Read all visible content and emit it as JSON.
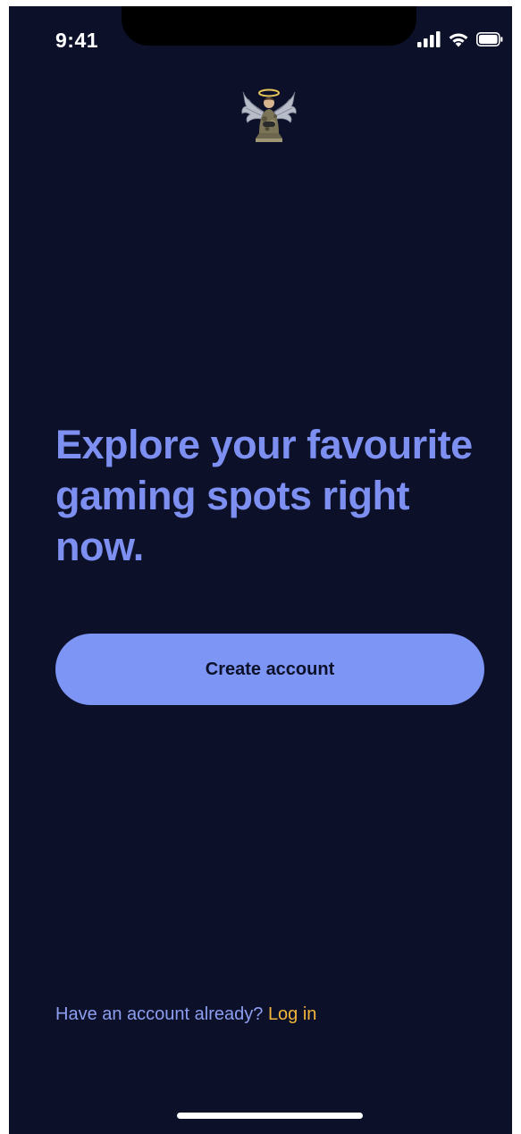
{
  "status_bar": {
    "time": "9:41",
    "icons": [
      "cellular-signal-icon",
      "wifi-icon",
      "battery-icon"
    ]
  },
  "brand": {
    "logo_icon": "winged-gamer-angel-logo-icon"
  },
  "hero": {
    "headline": "Explore your favourite gaming spots right now."
  },
  "actions": {
    "create_account_label": "Create account"
  },
  "footer": {
    "prompt": "Have an account already?",
    "login_label": "Log in"
  },
  "colors": {
    "background": "#0c1129",
    "accent": "#7d95f5",
    "headline": "#7d8ff0",
    "link": "#f3b53b"
  }
}
